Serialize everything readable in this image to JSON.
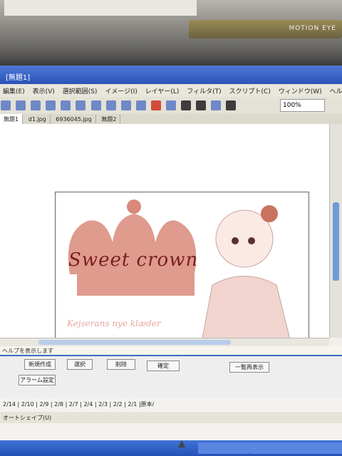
{
  "bezel": {
    "badge_text": "MOTION EYE"
  },
  "window": {
    "title": "[無題1]"
  },
  "menu": [
    "編集(E)",
    "表示(V)",
    "選択範囲(S)",
    "イメージ(I)",
    "レイヤー(L)",
    "フィルタ(T)",
    "スクリプト(C)",
    "ウィンドウ(W)",
    "ヘルプ(H)"
  ],
  "toolbar": {
    "zoom_value": "100%"
  },
  "tabs": [
    "無題1",
    "d1.jpg",
    "6936045.jpg",
    "無題2"
  ],
  "canvas": {
    "title_text": "Sweet crown",
    "caption_text": "Kejserans nye klæder"
  },
  "status": {
    "text": "ヘルプを表示します"
  },
  "panel": {
    "buttons": [
      "新規作成",
      "選択",
      "削除",
      "確定",
      "一覧再表示",
      "アラーム設定"
    ]
  },
  "schedule": {
    "dates": "2/14 | 2/10 | 2/9 | 2/8 | 2/7 | 2/4 | 2/3 | 2/2 | 2/1 |原本/",
    "draw_label": "オートシェイプ(U)"
  },
  "colors": {
    "crown": "#d8897a",
    "title_text": "#7a1e1e",
    "taskbar": "#2451b5"
  }
}
